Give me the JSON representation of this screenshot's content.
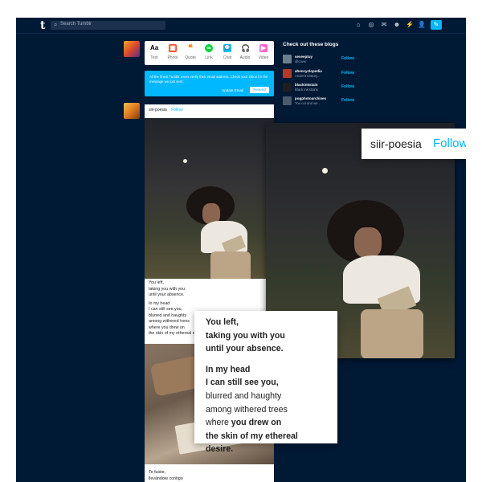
{
  "nav": {
    "logo": "t",
    "search_placeholder": "Search Tumblr",
    "icons": [
      "home-icon",
      "explore-icon",
      "inbox-icon",
      "messages-icon",
      "activity-icon",
      "account-icon",
      "compose-icon"
    ],
    "glyphs": {
      "home": "⌂",
      "explore": "◎",
      "inbox": "✉",
      "messages": "☻",
      "activity": "⚡",
      "account": "👤",
      "compose": "✎",
      "search": "⌕"
    },
    "accent": "#00b8ff",
    "background": "#001935"
  },
  "composer": {
    "types": [
      {
        "label": "Text",
        "glyph": "Aa",
        "color": "#000000"
      },
      {
        "label": "Photo",
        "glyph": "▣",
        "color": "#ff492f"
      },
      {
        "label": "Quote",
        "glyph": "❝",
        "color": "#ff8a00"
      },
      {
        "label": "Link",
        "glyph": "∞",
        "color": "#00cf35"
      },
      {
        "label": "Chat",
        "glyph": "💬",
        "color": "#00b8ff"
      },
      {
        "label": "Audio",
        "glyph": "🎧",
        "color": "#7c5cff"
      },
      {
        "label": "Video",
        "glyph": "▶",
        "color": "#ff62ce"
      }
    ]
  },
  "notice": {
    "text": "All the finest Tumblr users verify their email address. Check your inbox for the message we just sent.",
    "update_email": "Update Email",
    "resend": "Resend"
  },
  "post": {
    "blog": "siir-poesia",
    "follow": "Follow",
    "caption_lines": [
      "You left,",
      "taking you with you",
      "until your absence.",
      "In my head",
      "I can still see you,",
      "blurred and haughty",
      "among withered trees",
      "where you drew on",
      "the skin of my ethereal desire."
    ],
    "caption2_lines": [
      "Te fuiste,",
      "llevándote contigo"
    ]
  },
  "recommended": {
    "title": "Check out these blogs",
    "blogs": [
      {
        "name": "seveeptuy",
        "desc": "@cover",
        "follow": "Follow"
      },
      {
        "name": "ahencyclopedia",
        "desc": "Ancient History...",
        "follow": "Follow"
      },
      {
        "name": "blackinkstain",
        "desc": "Black ink stains",
        "follow": "Follow"
      },
      {
        "name": "pogphotoarchives",
        "desc": "You cut and we...",
        "follow": "Follow"
      }
    ]
  },
  "zoom": {
    "blog": "siir-poesia",
    "follow": "Follow",
    "caption": {
      "l1": "You left,",
      "l2": "taking you with you",
      "l3": "until your absence.",
      "l4": "In my head",
      "l5": "I can still see you,",
      "l6": "blurred and haughty",
      "l7": "among withered trees",
      "l8a": "where ",
      "l8b": "you drew on",
      "l9": "the skin of my ethereal desire."
    }
  }
}
